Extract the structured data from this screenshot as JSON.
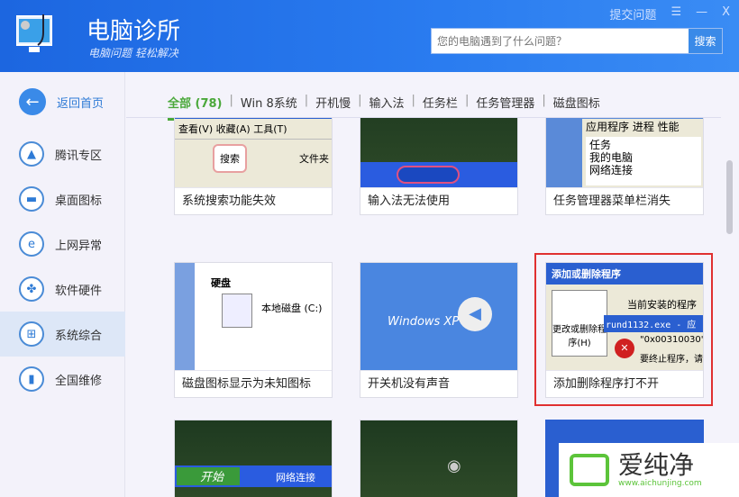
{
  "header": {
    "title": "电脑诊所",
    "slogan": "电脑问题 轻松解决",
    "submit": "提交问题",
    "menu": "☰",
    "min": "—",
    "close": "X",
    "search_placeholder": "您的电脑遇到了什么问题？",
    "search_button": "搜索"
  },
  "sidebar": {
    "back": "返回首页",
    "items": [
      {
        "label": "腾讯专区",
        "icon": "▲"
      },
      {
        "label": "桌面图标",
        "icon": "▬"
      },
      {
        "label": "上网异常",
        "icon": "e"
      },
      {
        "label": "软件硬件",
        "icon": "✤"
      },
      {
        "label": "系统综合",
        "icon": "⊞"
      },
      {
        "label": "全国维修",
        "icon": "▮"
      }
    ]
  },
  "tabs": [
    "全部 (78)",
    "Win 8系统",
    "开机慢",
    "输入法",
    "任务栏",
    "任务管理器",
    "磁盘图标"
  ],
  "cards": [
    {
      "title": "系统搜索功能失效",
      "thumb": {
        "menu": "查看(V)  收藏(A)  工具(T)",
        "btn": "搜索",
        "folder": "文件夹"
      }
    },
    {
      "title": "输入法无法使用"
    },
    {
      "title": "任务管理器菜单栏消失",
      "thumb": {
        "tabs": "应用程序  进程  性能",
        "head": "任务",
        "rows": [
          "我的电脑",
          "网络连接"
        ]
      }
    },
    {
      "title": "磁盘图标显示为未知图标",
      "thumb": {
        "head": "硬盘",
        "disk": "本地磁盘 (C:)"
      }
    },
    {
      "title": "开关机没有声音",
      "thumb": {
        "logo": "Windows XP"
      }
    },
    {
      "title": "添加删除程序打不开",
      "thumb": {
        "title": "添加或删除程序",
        "sub": "当前安装的程序",
        "btn": "更改或删除程序(H)",
        "err": "rund1132.exe - 应",
        "code": "\"0x00310030\"",
        "end": "要终止程序，请"
      }
    },
    {
      "title": "",
      "thumb": {
        "start": "开始",
        "net": "网络连接"
      }
    },
    {
      "title": ""
    }
  ],
  "watermark": {
    "text": "爱纯净",
    "url": "www.aichunjing.com"
  }
}
